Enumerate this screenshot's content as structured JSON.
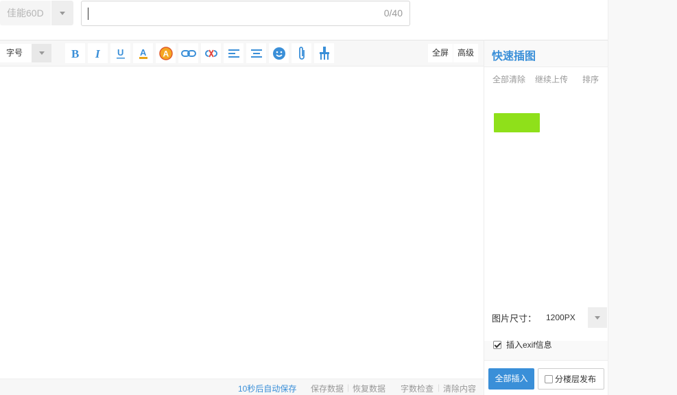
{
  "title_row": {
    "category_value": "佳能60D",
    "title_input_value": "",
    "title_counter": "0/40"
  },
  "toolbar": {
    "font_size_label": "字号",
    "buttons": [
      {
        "name": "bold-icon",
        "color": "#3a8fd8"
      },
      {
        "name": "italic-icon",
        "color": "#3a8fd8"
      },
      {
        "name": "underline-icon",
        "color": "#3a8fd8"
      },
      {
        "name": "font-color-icon",
        "color": "#3a8fd8"
      },
      {
        "name": "background-color-icon",
        "color": "#f0a020"
      },
      {
        "name": "link-icon",
        "color": "#3a8fd8"
      },
      {
        "name": "unlink-icon",
        "color": "#e0463e"
      },
      {
        "name": "align-left-icon",
        "color": "#3a8fd8"
      },
      {
        "name": "align-center-icon",
        "color": "#3a8fd8"
      },
      {
        "name": "emoji-icon",
        "color": "#3a8fd8"
      },
      {
        "name": "attachment-icon",
        "color": "#3a8fd8"
      },
      {
        "name": "clear-format-icon",
        "color": "#3a8fd8"
      }
    ],
    "fullscreen_label": "全屏",
    "advanced_label": "高级"
  },
  "statusbar": {
    "autosave": "10秒后自动保存",
    "save_data": "保存数据",
    "restore_data": "恢复数据",
    "word_check": "字数检查",
    "clear_content": "清除内容"
  },
  "sidebar": {
    "title": "快速插图",
    "clear_all": "全部清除",
    "continue_upload": "继续上传",
    "sort": "排序",
    "image_size_label": "图片尺寸：",
    "image_size_value": "1200PX",
    "exif_label": "插入exif信息",
    "exif_checked": true,
    "insert_all_label": "全部插入",
    "floor_publish_label": "分楼层发布",
    "floor_publish_checked": false
  },
  "colors": {
    "accent": "#3a8fd8",
    "thumbnail": "#8fe01a"
  }
}
